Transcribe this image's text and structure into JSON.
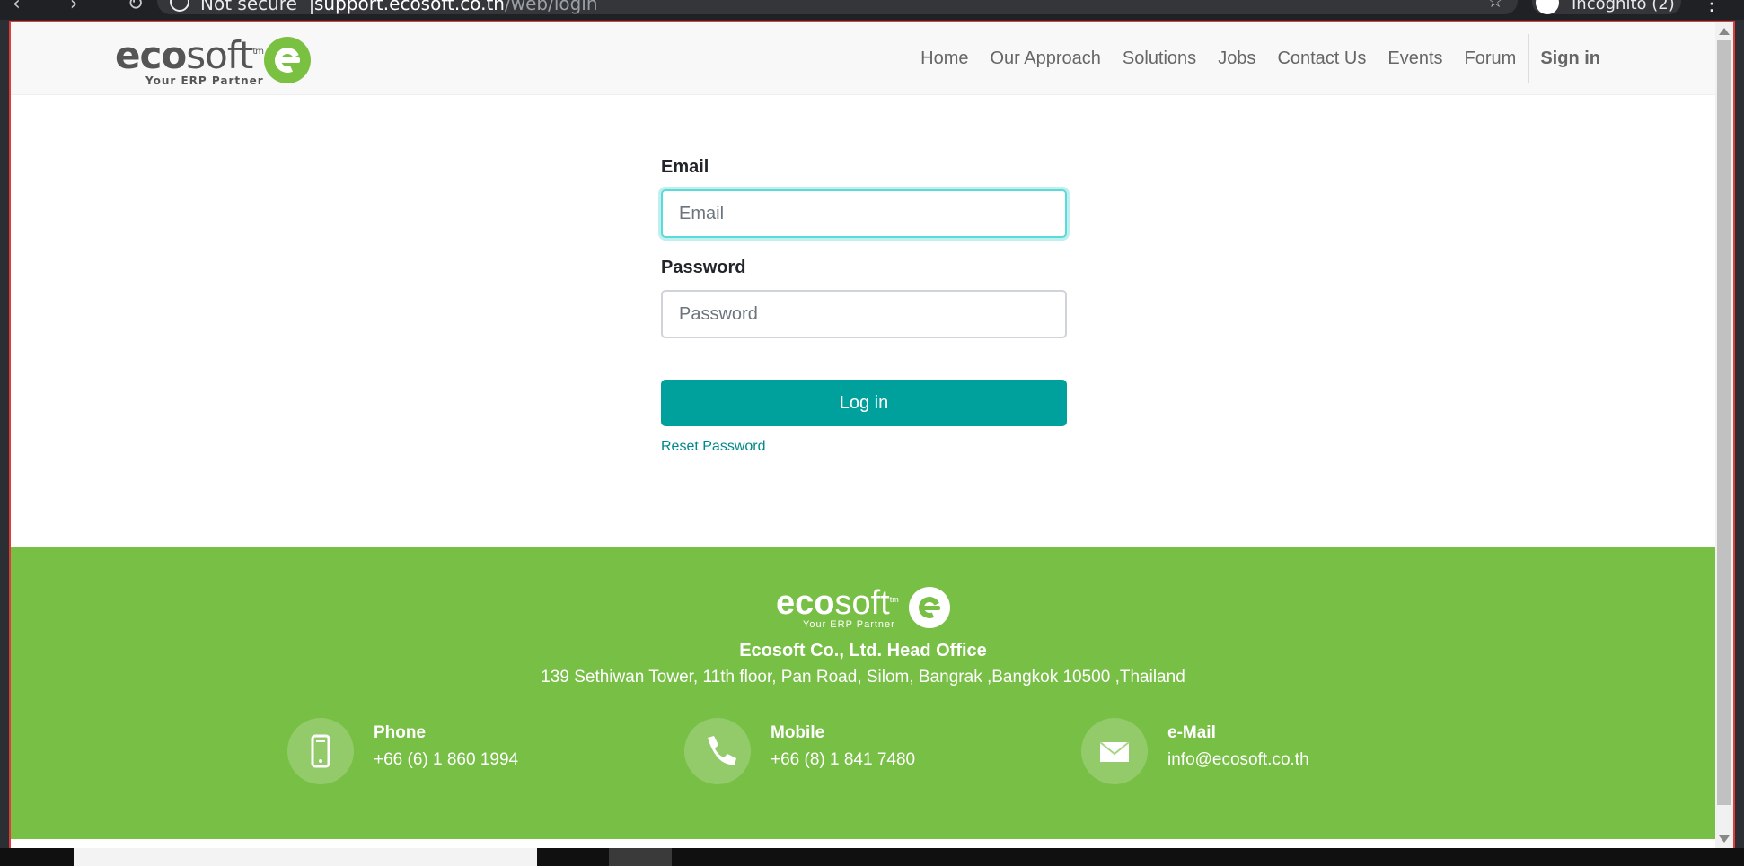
{
  "browser": {
    "nav_glyphs": "‹ › ↻",
    "security": "Not secure",
    "separator": "|",
    "url_host": "support.ecosoft.co.th",
    "url_path": "/web/login",
    "star": "☆",
    "profile_label": "Incognito (2)",
    "menu_glyph": "⋮"
  },
  "logo": {
    "eco": "eco",
    "soft": "soft",
    "tm": "tm",
    "tagline": "Your ERP Partner"
  },
  "nav": {
    "items": [
      "Home",
      "Our Approach",
      "Solutions",
      "Jobs",
      "Contact Us",
      "Events",
      "Forum"
    ],
    "sign_in": "Sign in"
  },
  "login": {
    "email_label": "Email",
    "email_placeholder": "Email",
    "password_label": "Password",
    "password_placeholder": "Password",
    "submit": "Log in",
    "reset": "Reset Password"
  },
  "footer": {
    "company": "Ecosoft Co., Ltd. Head Office",
    "address": "139 Sethiwan Tower, 11th floor, Pan Road, Silom, Bangrak ,Bangkok 10500 ,Thailand",
    "contacts": [
      {
        "title": "Phone",
        "value": "+66 (6) 1 860 1994",
        "icon": "phone-icon"
      },
      {
        "title": "Mobile",
        "value": "+66 (8) 1 841 7480",
        "icon": "handset-icon"
      },
      {
        "title": "e-Mail",
        "value": "info@ecosoft.co.th",
        "icon": "envelope-icon"
      }
    ]
  },
  "colors": {
    "brand_green": "#78bf46",
    "primary_button": "#00a09d",
    "link": "#00898a"
  }
}
